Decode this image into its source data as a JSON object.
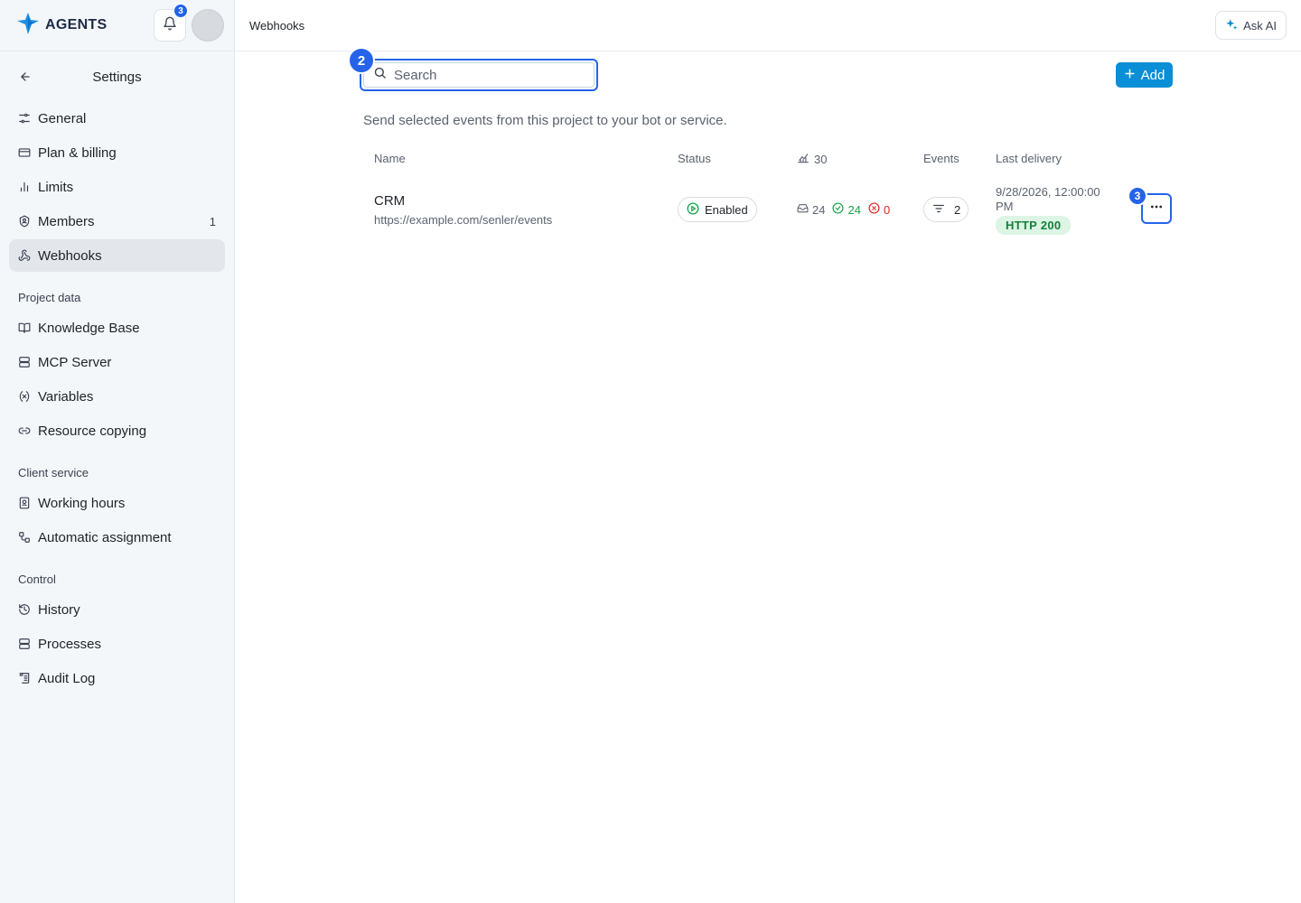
{
  "brand": {
    "name": "AGENTS",
    "notification_count": "3"
  },
  "topbar": {
    "title": "Webhooks",
    "ask_ai_label": "Ask AI"
  },
  "sidebar": {
    "title": "Settings",
    "items": [
      {
        "label": "General"
      },
      {
        "label": "Plan & billing"
      },
      {
        "label": "Limits"
      },
      {
        "label": "Members",
        "count": "1"
      },
      {
        "label": "Webhooks"
      }
    ],
    "sections": [
      {
        "label": "Project data",
        "items": [
          {
            "label": "Knowledge Base"
          },
          {
            "label": "MCP Server"
          },
          {
            "label": "Variables"
          },
          {
            "label": "Resource copying"
          }
        ]
      },
      {
        "label": "Client service",
        "items": [
          {
            "label": "Working hours"
          },
          {
            "label": "Automatic assignment"
          }
        ]
      },
      {
        "label": "Control",
        "items": [
          {
            "label": "History"
          },
          {
            "label": "Processes"
          },
          {
            "label": "Audit Log"
          }
        ]
      }
    ]
  },
  "main": {
    "search": {
      "placeholder": "Search",
      "value": ""
    },
    "add_label": "Add",
    "description": "Send selected events from this project to your bot or service.",
    "markers": {
      "search": "2",
      "more": "3"
    },
    "columns": {
      "name": "Name",
      "status": "Status",
      "requests": "30",
      "events": "Events",
      "last_delivery": "Last delivery"
    },
    "rows": [
      {
        "name": "CRM",
        "url": "https://example.com/senler/events",
        "status": "Enabled",
        "stats": {
          "total": "24",
          "success": "24",
          "failed": "0"
        },
        "events": "2",
        "last_delivery": "9/28/2026, 12:00:00 PM",
        "http_status": "HTTP 200"
      }
    ]
  },
  "colors": {
    "accent": "#2563eb",
    "add_button": "#0a8ed6",
    "success": "#16a34a",
    "error": "#dc2626"
  }
}
